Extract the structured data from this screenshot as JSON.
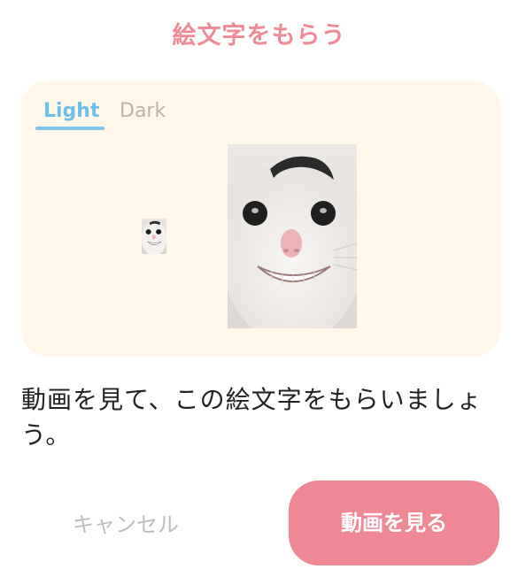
{
  "dialog": {
    "title": "絵文字をもらう"
  },
  "preview": {
    "tabs": [
      {
        "label": "Light",
        "selected": true
      },
      {
        "label": "Dark",
        "selected": false
      }
    ],
    "emoji_subject": "smiling-monkey-face"
  },
  "message": "動画を見て、この絵文字をもらいましょう。",
  "buttons": {
    "cancel_label": "キャンセル",
    "watch_video_label": "動画を見る"
  },
  "colors": {
    "title": "#ef8a97",
    "accent_tab": "#6ebde9",
    "card_background": "#fff8ea",
    "primary_button": "#ef8895",
    "cancel_text": "#bdbdbd"
  }
}
